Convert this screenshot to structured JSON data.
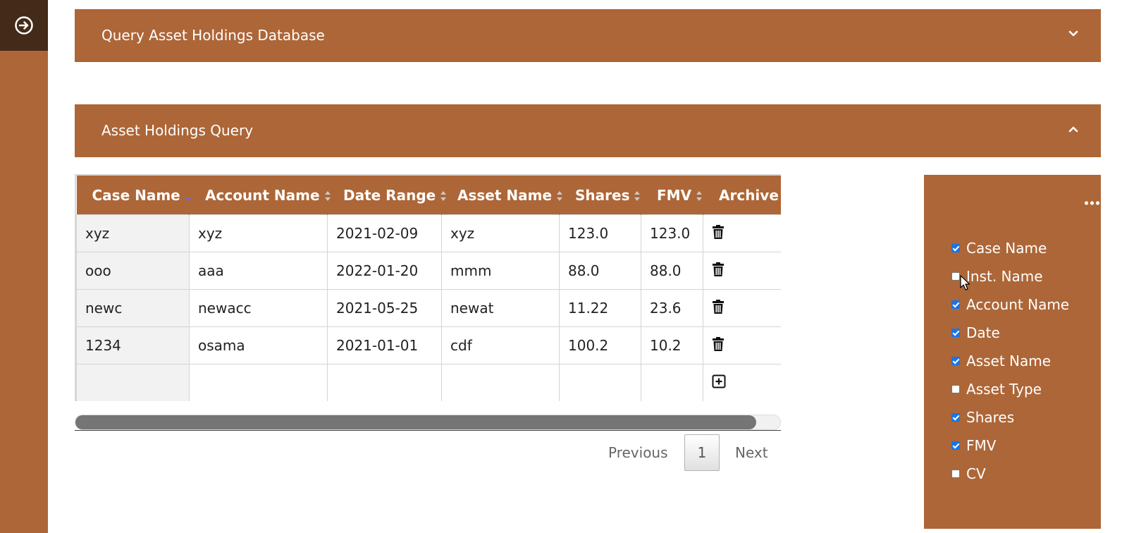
{
  "sidebar": {
    "toggle_icon": "arrow-circle-right-icon"
  },
  "panels": {
    "query_db": {
      "title": "Query Asset Holdings Database",
      "chevron": "chevron-down-icon"
    },
    "holdings_query": {
      "title": "Asset Holdings Query",
      "chevron": "chevron-up-icon"
    }
  },
  "table": {
    "columns": [
      "Case Name",
      "Account Name",
      "Date Range",
      "Asset Name",
      "Shares",
      "FMV",
      "Archive"
    ],
    "rows": [
      [
        "xyz",
        "xyz",
        "2021-02-09",
        "xyz",
        "123.0",
        "123.0"
      ],
      [
        "ooo",
        "aaa",
        "2022-01-20",
        "mmm",
        "88.0",
        "88.0"
      ],
      [
        "newc",
        "newacc",
        "2021-05-25",
        "newat",
        "11.22",
        "23.6"
      ],
      [
        "1234",
        "osama",
        "2021-01-01",
        "cdf",
        "100.2",
        "10.2"
      ]
    ],
    "row_action_icon": "trash-icon",
    "add_row_icon": "plus-square-icon"
  },
  "pagination": {
    "previous": "Previous",
    "current": "1",
    "next": "Next"
  },
  "column_chooser": {
    "menu_icon": "ellipsis-icon",
    "items": [
      {
        "label": "Case Name",
        "checked": true
      },
      {
        "label": "Inst. Name",
        "checked": false
      },
      {
        "label": "Account Name",
        "checked": true
      },
      {
        "label": "Date",
        "checked": true
      },
      {
        "label": "Asset Name",
        "checked": true
      },
      {
        "label": "Asset Type",
        "checked": false
      },
      {
        "label": "Shares",
        "checked": true
      },
      {
        "label": "FMV",
        "checked": true
      },
      {
        "label": "CV",
        "checked": false
      }
    ]
  },
  "colors": {
    "accent": "#ad6637",
    "sidebar_top": "#432a19"
  }
}
